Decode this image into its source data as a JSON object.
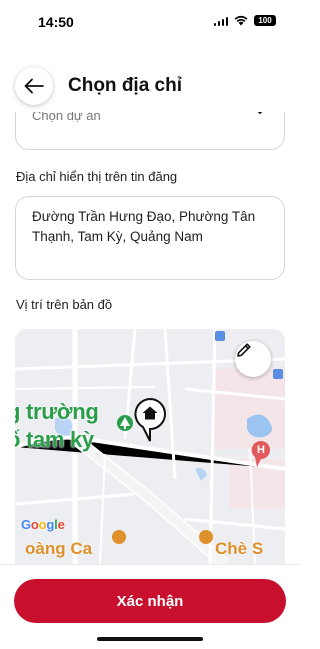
{
  "status_bar": {
    "time": "14:50",
    "battery": "100",
    "icons": [
      "signal-icon",
      "wifi-icon",
      "battery-icon"
    ]
  },
  "header": {
    "title": "Chọn địa chỉ",
    "back_icon": "arrow-left-icon"
  },
  "form": {
    "project_select": {
      "value": "Chọn dự án",
      "icon": "chevron-down-icon"
    },
    "address_label": "Địa chỉ hiển thị trên tin đăng",
    "address_value": "Đường Trần Hưng Đạo, Phường Tân Thạnh, Tam Kỳ, Quảng Nam",
    "map_label": "Vị trí trên bản đồ"
  },
  "map": {
    "place_label_line1": "g trường",
    "place_label_line2": "ố tam kỳ",
    "place_label_bottom_left": "oàng Ca",
    "place_label_bottom_right": "Chè S",
    "google_logo": "Google",
    "edit_icon": "pencil-icon",
    "marker_icon": "home-marker-icon",
    "hospital_marker_text": "H"
  },
  "footer": {
    "confirm_label": "Xác nhận"
  },
  "colors": {
    "primary": "#c8102e",
    "map_green": "#2a9d4b",
    "map_road": "#ffffff",
    "map_water": "#9cc4f2"
  }
}
